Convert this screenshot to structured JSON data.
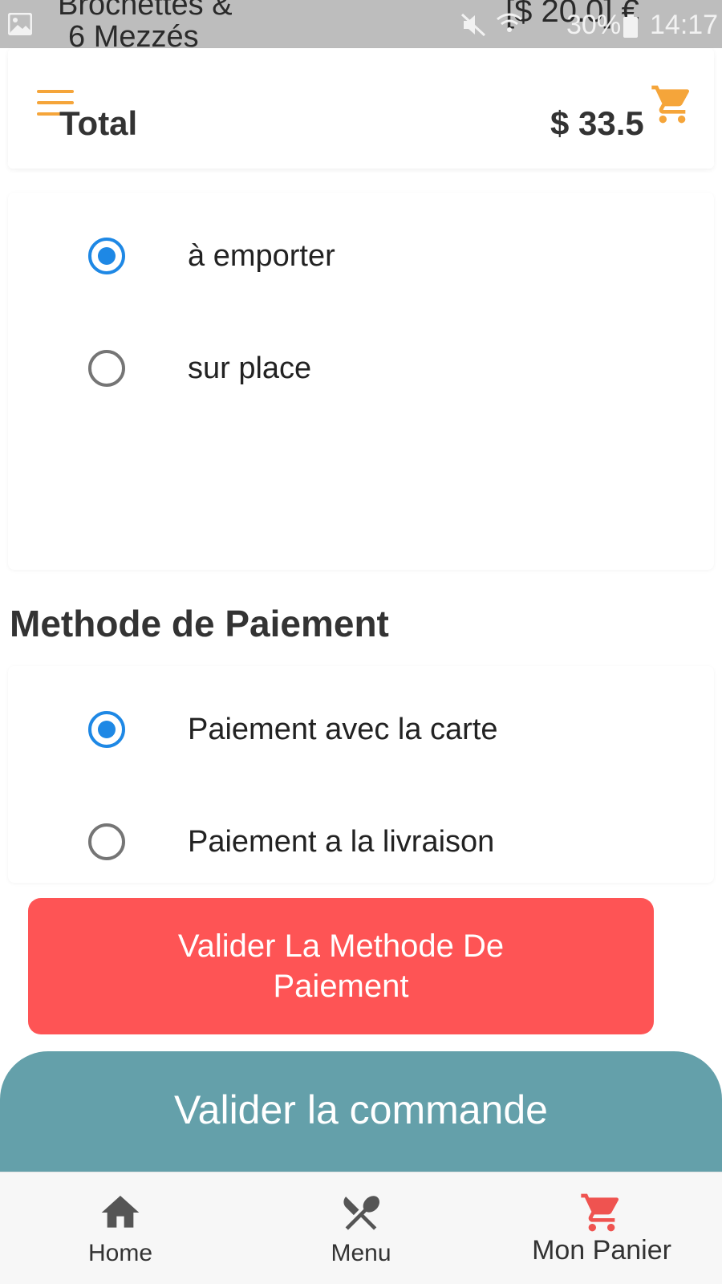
{
  "status_bar": {
    "overlap_title_line1": "Brochettes &",
    "overlap_title_line2": "6 Mezzés",
    "overlap_price": "[$ 20.0] €",
    "battery": "30%",
    "time": "14:17"
  },
  "header": {
    "total_label": "Total",
    "total_value": "$ 33.5"
  },
  "order_type": {
    "options": [
      {
        "label": "à emporter",
        "checked": true
      },
      {
        "label": "sur place",
        "checked": false
      }
    ]
  },
  "payment": {
    "title": "Methode de Paiement",
    "options": [
      {
        "label": "Paiement avec la carte",
        "checked": true
      },
      {
        "label": "Paiement a la livraison",
        "checked": false
      }
    ],
    "validate_button": "Valider La Methode De Paiement"
  },
  "order": {
    "validate_button": "Valider la commande"
  },
  "bottom_nav": {
    "items": [
      {
        "label": "Home",
        "icon": "home-icon",
        "active": false
      },
      {
        "label": "Menu",
        "icon": "utensils-icon",
        "active": false
      },
      {
        "label": "Mon Panier",
        "icon": "cart-icon",
        "active": true
      }
    ]
  },
  "colors": {
    "accent_orange": "#f5a53a",
    "radio_blue": "#1e88e5",
    "button_red": "#fe5455",
    "button_teal": "#64a0aa",
    "cart_red": "#ef5350"
  }
}
